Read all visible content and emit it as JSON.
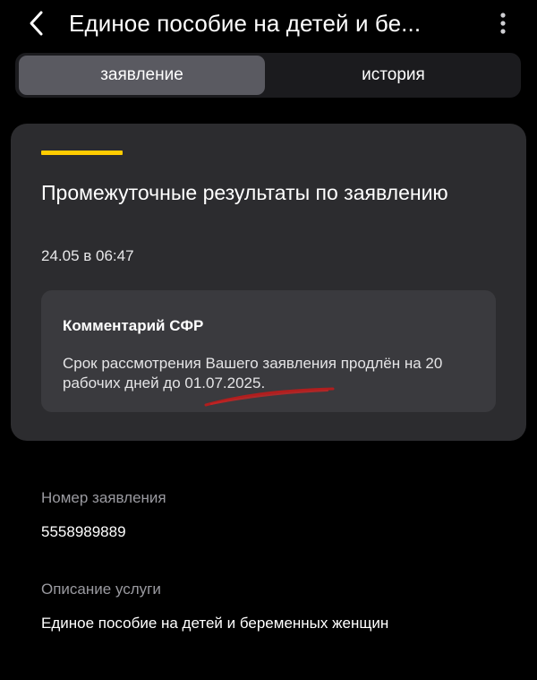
{
  "header": {
    "title": "Единое пособие на детей и бе...",
    "back_icon": "chevron-left-icon",
    "more_icon": "more-vertical-icon"
  },
  "tabs": [
    {
      "label": "заявление",
      "active": true
    },
    {
      "label": "история",
      "active": false
    }
  ],
  "status_card": {
    "accent_color": "#ffcc00",
    "title": "Промежуточные результаты по заявлению",
    "date": "24.05 в 06:47",
    "comment": {
      "title": "Комментарий СФР",
      "text": "Срок рассмотрения Вашего заявления продлён на 20 рабочих дней до 01.07.2025."
    }
  },
  "details": {
    "application_number_label": "Номер заявления",
    "application_number": "5558989889",
    "service_description_label": "Описание услуги",
    "service_description": "Единое пособие на детей и беременных женщин"
  }
}
